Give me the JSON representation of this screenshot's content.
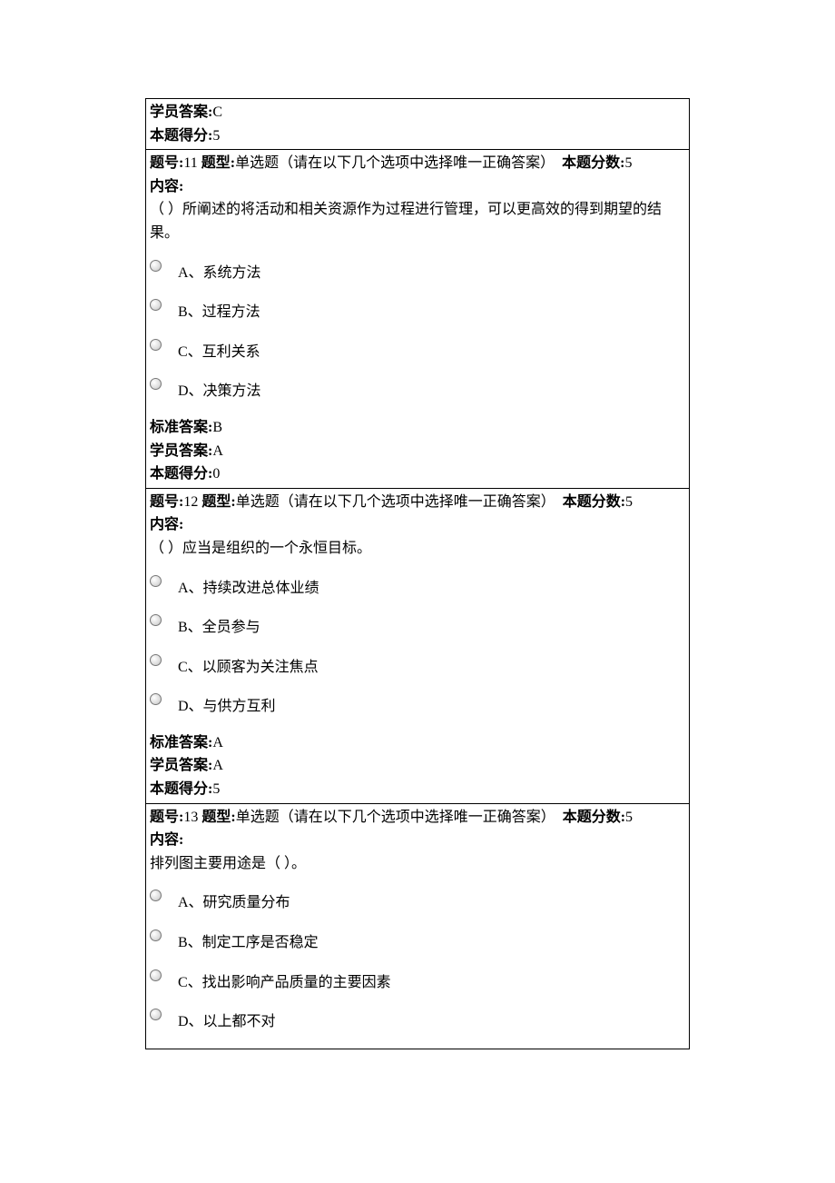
{
  "labels": {
    "student_ans": "学员答案:",
    "score_got": "本题得分:",
    "q_no": "题号:",
    "q_type": "题型:",
    "type_desc": "单选题（请在以下几个选项中选择唯一正确答案）",
    "q_score": "本题分数:",
    "content": "内容:",
    "std_ans": "标准答案:"
  },
  "top": {
    "student_ans": "C",
    "score_got": "5"
  },
  "questions": [
    {
      "no": "11",
      "score": "5",
      "body": "（ ）所阐述的将活动和相关资源作为过程进行管理，可以更高效的得到期望的结果。",
      "options": [
        "A、系统方法",
        "B、过程方法",
        "C、互利关系",
        "D、决策方法"
      ],
      "std_ans": "B",
      "student_ans": "A",
      "score_got": "0"
    },
    {
      "no": "12",
      "score": "5",
      "body": "（ ）应当是组织的一个永恒目标。",
      "options": [
        "A、持续改进总体业绩",
        "B、全员参与",
        "C、以顾客为关注焦点",
        "D、与供方互利"
      ],
      "std_ans": "A",
      "student_ans": "A",
      "score_got": "5"
    },
    {
      "no": "13",
      "score": "5",
      "body": "排列图主要用途是（ ）。",
      "options": [
        "A、研究质量分布",
        "B、制定工序是否稳定",
        "C、找出影响产品质量的主要因素",
        "D、以上都不对"
      ],
      "std_ans": "",
      "student_ans": "",
      "score_got": ""
    }
  ]
}
